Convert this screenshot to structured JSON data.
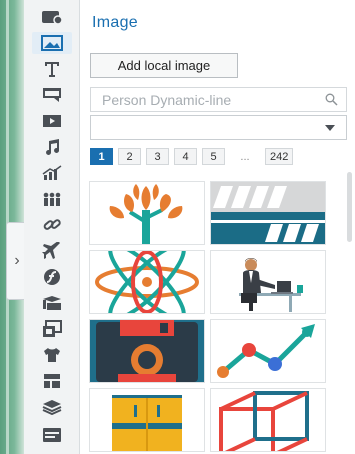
{
  "panel": {
    "title": "Image",
    "add_button": "Add local image",
    "search_placeholder": "Person Dynamic-line",
    "category_value": ""
  },
  "pagination": {
    "pages": [
      "1",
      "2",
      "3",
      "4",
      "5"
    ],
    "ellipsis": "...",
    "last": "242",
    "current": "1"
  },
  "rail_icons": [
    "shape-icon",
    "image-icon",
    "text-icon",
    "frame-icon",
    "video-icon",
    "music-icon",
    "chart-icon",
    "people-icon",
    "link-icon",
    "airplane-icon",
    "flash-icon",
    "component-icon",
    "module-icon",
    "tshirt-icon",
    "layout-icon",
    "layers-icon",
    "background-icon"
  ],
  "images": [
    "tree-image",
    "barcode-stripes-image",
    "atom-image",
    "person-at-desk-image",
    "floppy-disk-image",
    "line-chart-image",
    "cabinet-image",
    "wire-cube-image"
  ],
  "colors": {
    "accent": "#1a6fb0",
    "rail_icon": "#4a4f55"
  }
}
